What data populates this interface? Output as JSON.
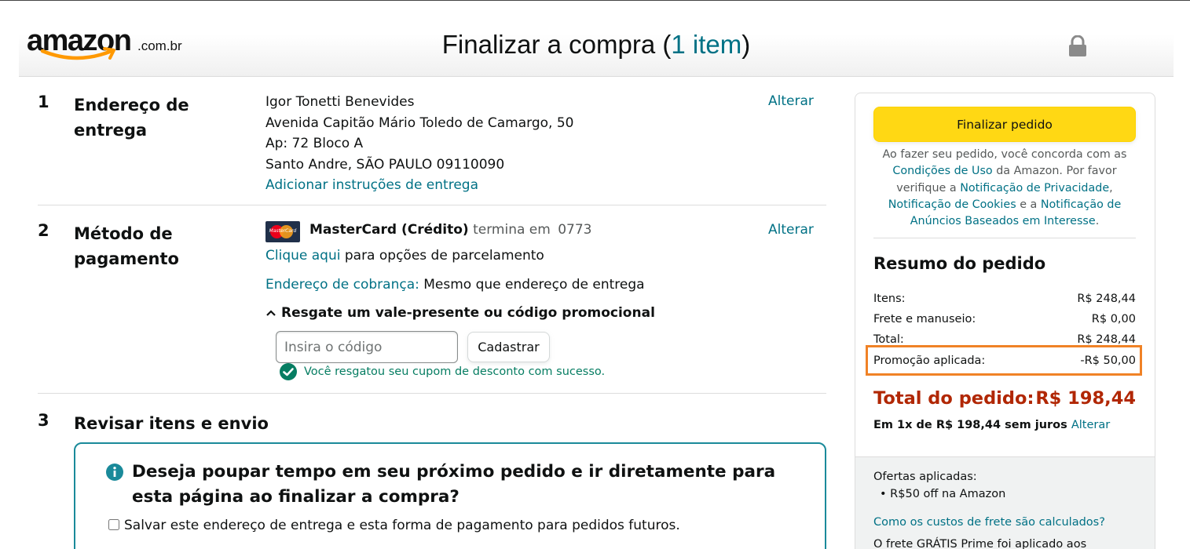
{
  "header": {
    "logo_word": "amazon",
    "logo_tld": ".com.br",
    "title_prefix": "Finalizar a compra (",
    "title_count": "1 item",
    "title_suffix": ")"
  },
  "address": {
    "number": "1",
    "title": "Endereço de entrega",
    "name": "Igor Tonetti Benevides",
    "street": "Avenida Capitão Mário Toledo de Camargo, 50",
    "apt": "Ap: 72 Bloco A",
    "city": "Santo Andre, SÃO PAULO 09110090",
    "instructions_link": "Adicionar instruções de entrega",
    "change": "Alterar"
  },
  "payment": {
    "number": "2",
    "title": "Método de pagamento",
    "card_logo_text": "MasterCard",
    "card_name": "MasterCard (Crédito)",
    "ends_label": "termina em",
    "last_digits": "0773",
    "change": "Alterar",
    "installments_link": "Clique aqui",
    "installments_text": " para opções de parcelamento",
    "billing_link": "Endereço de cobrança:",
    "billing_text": " Mesmo que endereço de entrega",
    "promo_header": "Resgate um vale-presente ou código promocional",
    "code_placeholder": "Insira o código",
    "register_button": "Cadastrar",
    "success_msg": "Você resgatou seu cupom de desconto com sucesso."
  },
  "review": {
    "number": "3",
    "title": "Revisar itens e envio",
    "question": "Deseja poupar tempo em seu próximo pedido e ir diretamente para esta página ao finalizar a compra?",
    "save_checkbox": "Salvar este endereço de entrega e esta forma de pagamento para pedidos futuros."
  },
  "sidebar": {
    "place_order": "Finalizar pedido",
    "terms_1": "Ao fazer seu pedido, você concorda com as ",
    "terms_link_1": "Condições de Uso",
    "terms_2": " da Amazon. Por favor verifique a ",
    "terms_link_2": "Notificação de Privacidade",
    "terms_3": ", ",
    "terms_link_3": "Notificação de Cookies",
    "terms_4": " e a ",
    "terms_link_4": "Notificação de Anúncios Baseados em Interesse",
    "terms_5": ".",
    "summary_title": "Resumo do pedido",
    "rows": [
      {
        "label": "Itens:",
        "value": "R$ 248,44"
      },
      {
        "label": "Frete e manuseio:",
        "value": "R$ 0,00"
      },
      {
        "label": "Total:",
        "value": "R$ 248,44"
      },
      {
        "label": "Promoção aplicada:",
        "value": "-R$ 50,00"
      }
    ],
    "total_label": "Total do pedido:",
    "total_value": "R$ 198,44",
    "installment_text": "Em 1x de R$ 198,44 sem juros ",
    "installment_link": "Alterar",
    "offers_title": "Ofertas aplicadas:",
    "offer_item": "R$50 off na Amazon",
    "shipping_link": "Como os custos de frete são calculados?",
    "shipping_text": "O frete GRÁTIS Prime foi aplicado aos"
  },
  "colors": {
    "accent_link": "#007185",
    "button_yellow": "#ffd814",
    "total_red": "#b12704",
    "highlight_orange": "#f08226",
    "success_green": "#067d62"
  }
}
